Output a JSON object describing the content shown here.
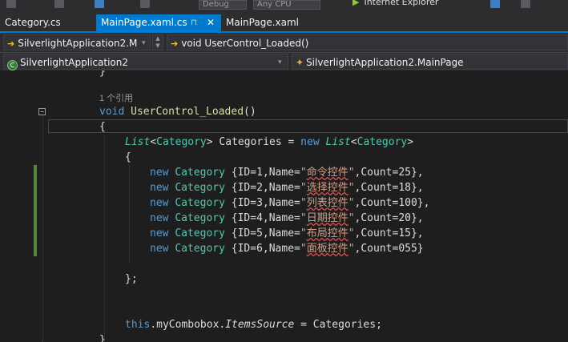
{
  "toolbar": {
    "debug": "Debug",
    "cpu": "Any CPU",
    "run_target": "Internet Explorer"
  },
  "tabs": [
    {
      "label": "Category.cs"
    },
    {
      "label": "MainPage.xaml.cs",
      "pin": "⊓",
      "close": "✕"
    },
    {
      "label": "MainPage.xaml"
    }
  ],
  "nav": {
    "type_selector": "SilverlightApplication2.M",
    "member_selector": "void UserControl_Loaded()"
  },
  "project": {
    "project_selector": "SilverlightApplication2",
    "class_selector": "SilverlightApplication2.MainPage"
  },
  "code": {
    "brace_close": "}",
    "ref_count": "1 个引用",
    "kw_void": "void",
    "method_name": "UserControl_Loaded",
    "parens": "()",
    "open_brace": "{",
    "list_type": "List",
    "generic_open": "<",
    "generic_close": ">",
    "category": "Category",
    "var_decl": " Categories = ",
    "kw_new": "new",
    "inner_open": "{",
    "rows": [
      {
        "prefix": " {ID=1,Name=",
        "quote_open": "\"",
        "name": "命令控件",
        "quote_close": "\"",
        "suffix": ",Count=25},"
      },
      {
        "prefix": " {ID=2,Name=",
        "quote_open": "\"",
        "name": "选择控件",
        "quote_close": "\"",
        "suffix": ",Count=18},"
      },
      {
        "prefix": " {ID=3,Name=",
        "quote_open": "\"",
        "name": "列表控件",
        "quote_close": "\"",
        "suffix": ",Count=100},"
      },
      {
        "prefix": " {ID=4,Name=",
        "quote_open": "\"",
        "name": "日期控件",
        "quote_close": "\"",
        "suffix": ",Count=20},"
      },
      {
        "prefix": " {ID=5,Name=",
        "quote_open": "\"",
        "name": "布局控件",
        "quote_close": "\"",
        "suffix": ",Count=15},"
      },
      {
        "prefix": " {ID=6,Name=",
        "quote_open": "\"",
        "name": "面板控件",
        "quote_close": "\"",
        "suffix": ",Count=055}"
      }
    ],
    "close_stmt": "};",
    "kw_this": "this",
    "dot1": ".myCombobox.",
    "items_source": "ItemsSource",
    "assign": " = Categories;",
    "final_brace": "}"
  },
  "colors": {
    "accent": "#007acc",
    "keyword": "#569cd6",
    "type": "#4ec9b0",
    "string": "#d69d85",
    "method": "#dcdcaa",
    "change_bar": "#57863e"
  }
}
